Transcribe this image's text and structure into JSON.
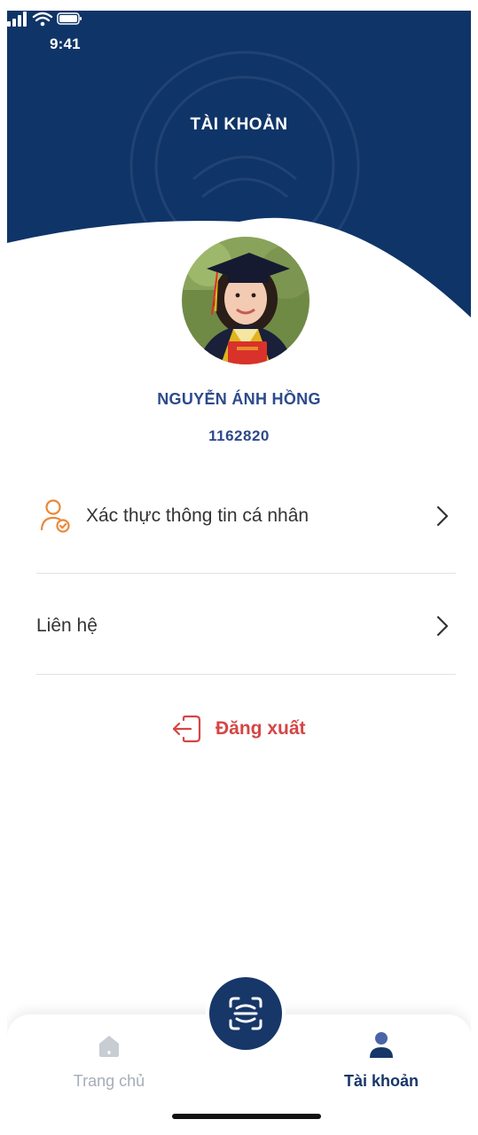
{
  "status_bar": {
    "time": "9:41"
  },
  "header": {
    "title": "TÀI KHOẢN",
    "background_color": "#0f3468"
  },
  "profile": {
    "name": "NGUYỄN ÁNH HỒNG",
    "student_id": "1162820",
    "avatar_icon": "graduate-photo"
  },
  "menu": {
    "verify_label": "Xác thực thông tin cá nhân",
    "verify_icon": "person-check-icon",
    "contact_label": "Liên hệ",
    "chevron_icon": "chevron-right-icon"
  },
  "logout": {
    "label": "Đăng xuất",
    "icon": "logout-icon",
    "color": "#d64545"
  },
  "bottom_nav": {
    "home_label": "Trang chủ",
    "account_label": "Tài khoản",
    "scan_icon": "scan-icon",
    "active": "Tài khoản",
    "active_color": "#173768",
    "inactive_color": "#a6adb8"
  }
}
